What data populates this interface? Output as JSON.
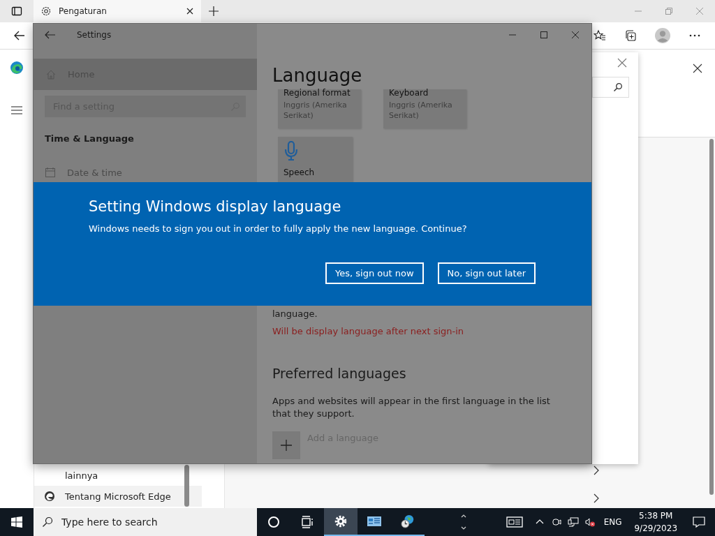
{
  "browser": {
    "tab": {
      "title": "Pengaturan",
      "selected": true
    },
    "menu_items": [
      {
        "label": "lainnya",
        "selected": false
      },
      {
        "label": "Tentang Microsoft Edge",
        "selected": true
      }
    ]
  },
  "settings_window": {
    "title": "Settings",
    "sidebar": {
      "home": "Home",
      "search_placeholder": "Find a setting",
      "section": "Time & Language",
      "items": [
        {
          "label": "Date & time"
        }
      ]
    },
    "content": {
      "heading": "Language",
      "tiles": [
        {
          "kind": "text",
          "title": "Regional format",
          "subtitle": "Inggris (Amerika Serikat)"
        },
        {
          "kind": "text",
          "title": "Keyboard",
          "subtitle": "Inggris (Amerika Serikat)"
        },
        {
          "kind": "speech",
          "title": "Speech"
        }
      ],
      "note": "language.",
      "status": "Will be display language after next sign-in",
      "preferred_heading": "Preferred languages",
      "preferred_text": "Apps and websites will appear in the first language in the list that they support.",
      "add_language": "Add a language"
    }
  },
  "dialog": {
    "title": "Setting Windows display language",
    "message": "Windows needs to sign you out in order to fully apply the new language. Continue?",
    "buttons": [
      "Yes, sign out now",
      "No, sign out later"
    ]
  },
  "taskbar": {
    "search_placeholder": "Type here to search",
    "apps": [
      {
        "kind": "settings",
        "selected": true
      },
      {
        "kind": "control-panel",
        "selected": false
      },
      {
        "kind": "globe",
        "selected": false
      }
    ],
    "language": "ENG",
    "time": "5:38 PM",
    "date": "9/29/2023"
  }
}
